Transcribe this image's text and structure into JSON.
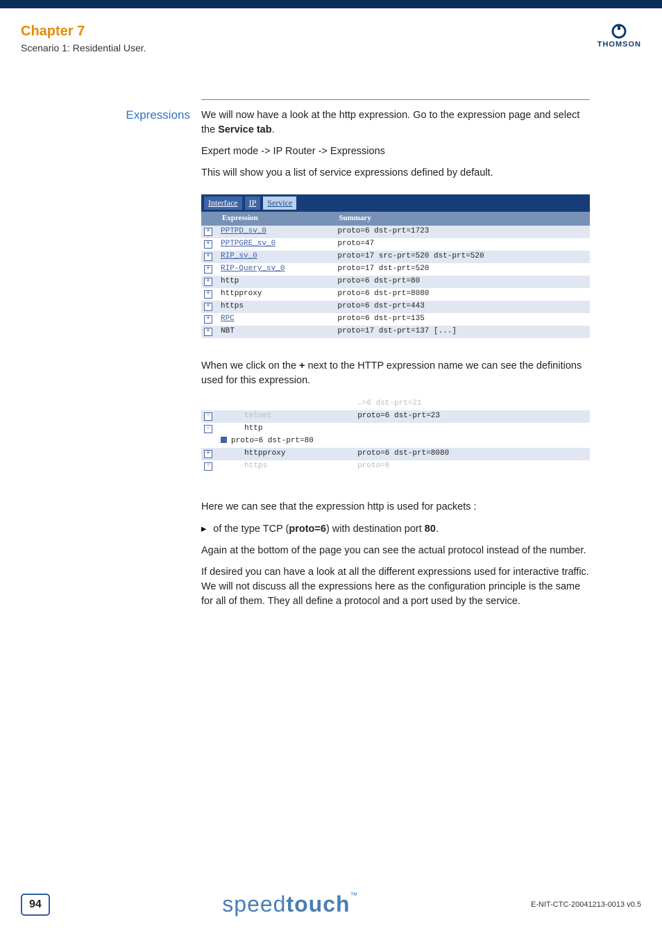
{
  "header": {
    "chapter": "Chapter 7",
    "subtitle": "Scenario 1: Residential User.",
    "brand": "THOMSON"
  },
  "sidebar": {
    "heading": "Expressions"
  },
  "intro": {
    "p1a": "We will now have a look at the http expression. Go to the expression page and select the ",
    "p1b": "Service tab",
    "p1c": ".",
    "p2": "Expert mode -> IP Router -> Expressions",
    "p3": "This will show you a list of service expressions defined by default."
  },
  "tabs": {
    "interface": "Interface",
    "ip": "IP",
    "service": "Service"
  },
  "tableHeaders": {
    "expr": "Expression",
    "summary": "Summary"
  },
  "rows": [
    {
      "name": "PPTPD_sv_0",
      "sum": "proto=6 dst-prt=1723"
    },
    {
      "name": "PPTPGRE_sv_0",
      "sum": "proto=47"
    },
    {
      "name": "RIP_sv_0",
      "sum": "proto=17 src-prt=520 dst-prt=520"
    },
    {
      "name": "RIP-Query_sv_0",
      "sum": "proto=17 dst-prt=520"
    },
    {
      "name": "http",
      "sum": "proto=6 dst-prt=80"
    },
    {
      "name": "httpproxy",
      "sum": "proto=6 dst-prt=8080"
    },
    {
      "name": "https",
      "sum": "proto=6 dst-prt=443"
    },
    {
      "name": "RPC",
      "sum": "proto=6 dst-prt=135"
    },
    {
      "name": "NBT",
      "sum": "proto=17 dst-prt=137 [...]"
    }
  ],
  "mid": {
    "p1a": "When we click on the ",
    "p1b": "+",
    "p1c": " next to the HTTP expression name we can see the definitions used for this expression."
  },
  "shot2": {
    "r0sum": "…=6 dst-prt=21",
    "r1name": "telnet",
    "r1sum": "proto=6 dst-prt=23",
    "r2name": "http",
    "detail": "proto=6 dst-prt=80",
    "r3name": "httpproxy",
    "r3sum": "proto=6 dst-prt=8080",
    "r4name": "https",
    "r4sum": "proto=6"
  },
  "after": {
    "p1": "Here we can see that the expression http is used for packets :",
    "b1a": "of the type TCP (",
    "b1b": "proto=6",
    "b1c": ") with destination port ",
    "b1d": "80",
    "b1e": ".",
    "p2": "Again at the bottom of the page you can see the actual protocol instead of the number.",
    "p3": "If desired you can have a look at all the different expressions used for interactive traffic. We will not discuss all the expressions here as the configuration principle is the same for all of them. They all define a protocol and a port used by the service."
  },
  "footer": {
    "page": "94",
    "logo_light": "speed",
    "logo_bold": "touch",
    "docid": "E-NIT-CTC-20041213-0013 v0.5"
  }
}
